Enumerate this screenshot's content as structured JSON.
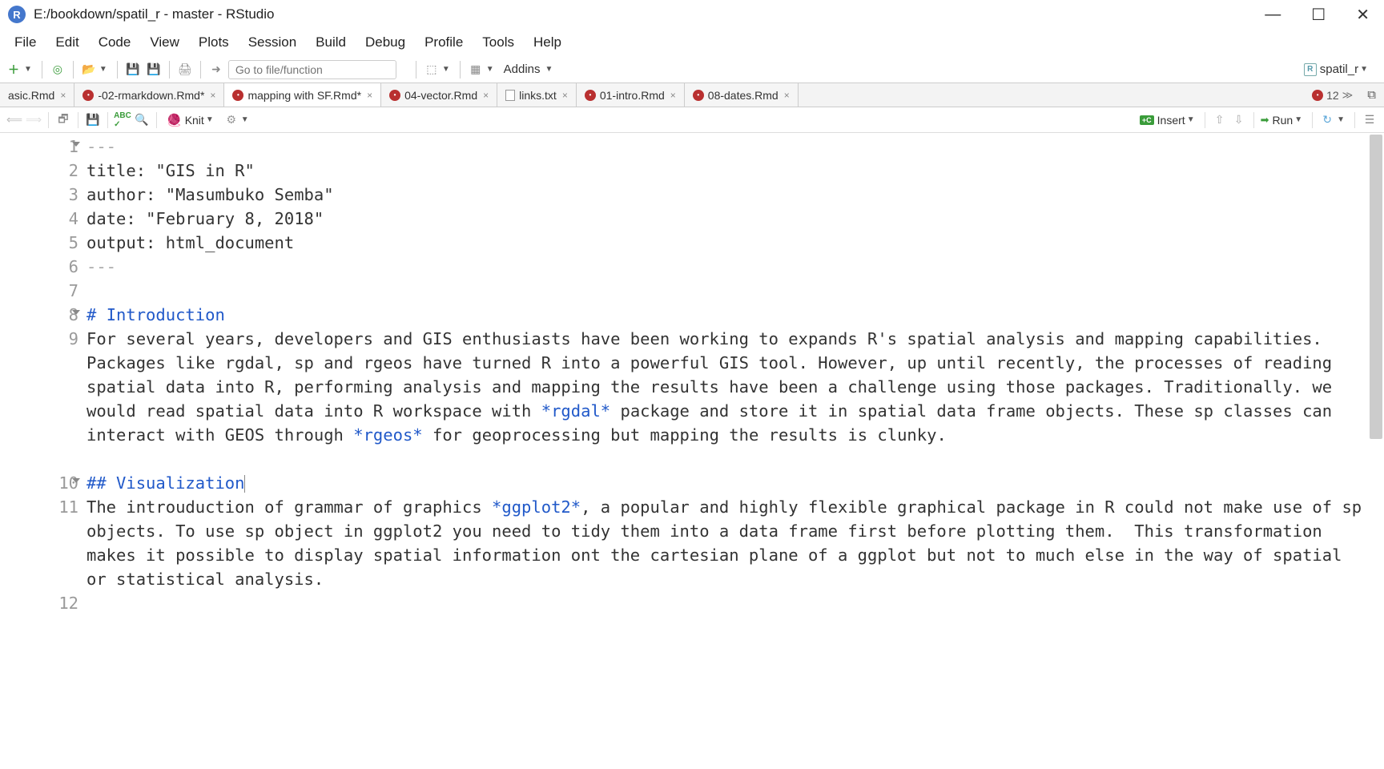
{
  "window_title": "E:/bookdown/spatil_r - master - RStudio",
  "menus": [
    "File",
    "Edit",
    "Code",
    "View",
    "Plots",
    "Session",
    "Build",
    "Debug",
    "Profile",
    "Tools",
    "Help"
  ],
  "goto_placeholder": "Go to file/function",
  "addins_label": "Addins",
  "project_name": "spatil_r",
  "tabs": [
    {
      "label": "asic.Rmd",
      "icon": "none",
      "modified": false
    },
    {
      "label": "-02-rmarkdown.Rmd*",
      "icon": "rmd",
      "modified": true
    },
    {
      "label": "mapping with SF.Rmd*",
      "icon": "rmd",
      "modified": true,
      "active": true
    },
    {
      "label": "04-vector.Rmd",
      "icon": "rmd",
      "modified": false
    },
    {
      "label": "links.txt",
      "icon": "txt",
      "modified": false
    },
    {
      "label": "01-intro.Rmd",
      "icon": "rmd",
      "modified": false
    },
    {
      "label": "08-dates.Rmd",
      "icon": "rmd",
      "modified": false
    }
  ],
  "tab_overflow": "12",
  "editor_toolbar": {
    "knit": "Knit",
    "insert": "Insert",
    "run": "Run"
  },
  "code": {
    "lines": [
      {
        "n": "1",
        "fold": true,
        "type": "fm-delim",
        "text": "---"
      },
      {
        "n": "2",
        "type": "fm",
        "key": "title",
        "val": "\"GIS in R\""
      },
      {
        "n": "3",
        "type": "fm",
        "key": "author",
        "val": "\"Masumbuko Semba\""
      },
      {
        "n": "4",
        "type": "fm",
        "key": "date",
        "val": "\"February 8, 2018\""
      },
      {
        "n": "5",
        "type": "fm",
        "key": "output",
        "val": "html_document"
      },
      {
        "n": "6",
        "type": "fm-delim",
        "text": "---"
      },
      {
        "n": "7",
        "type": "blank",
        "text": ""
      },
      {
        "n": "8",
        "fold": true,
        "type": "h1",
        "hash": "#",
        "text": "Introduction"
      },
      {
        "n": "9",
        "type": "para",
        "parts": [
          {
            "t": "For several years, developers and GIS enthusiasts have been working to expands R's spatial analysis and mapping capabilities. Packages like rgdal, sp and rgeos have turned R into a powerful GIS tool. However, up until recently, the processes of reading spatial data into R, performing analysis and mapping the results have been a challenge using those packages. Traditionally. we would read spatial data into R workspace with "
          },
          {
            "em": "*rgdal*"
          },
          {
            "t": " package and store it in spatial data frame objects. These sp classes can interact with GEOS through "
          },
          {
            "em": "*rgeos*"
          },
          {
            "t": " for geoprocessing but mapping the results is clunky."
          }
        ]
      },
      {
        "n": "",
        "type": "blank",
        "text": ""
      },
      {
        "n": "10",
        "fold": true,
        "type": "h2",
        "hash": "##",
        "text": "Visualization",
        "cursor": true
      },
      {
        "n": "11",
        "type": "para",
        "parts": [
          {
            "t": "The introuduction of grammar of graphics "
          },
          {
            "em": "*ggplot2*"
          },
          {
            "t": ", a popular and highly flexible graphical package in R could not make use of sp objects. To use sp object in ggplot2 you need to tidy them into a data frame first before plotting them.  This transformation makes it possible to display spatial information ont the cartesian plane of a ggplot but not to much else in the way of spatial or statistical analysis."
          }
        ]
      },
      {
        "n": "12",
        "type": "blank",
        "text": ""
      }
    ]
  }
}
